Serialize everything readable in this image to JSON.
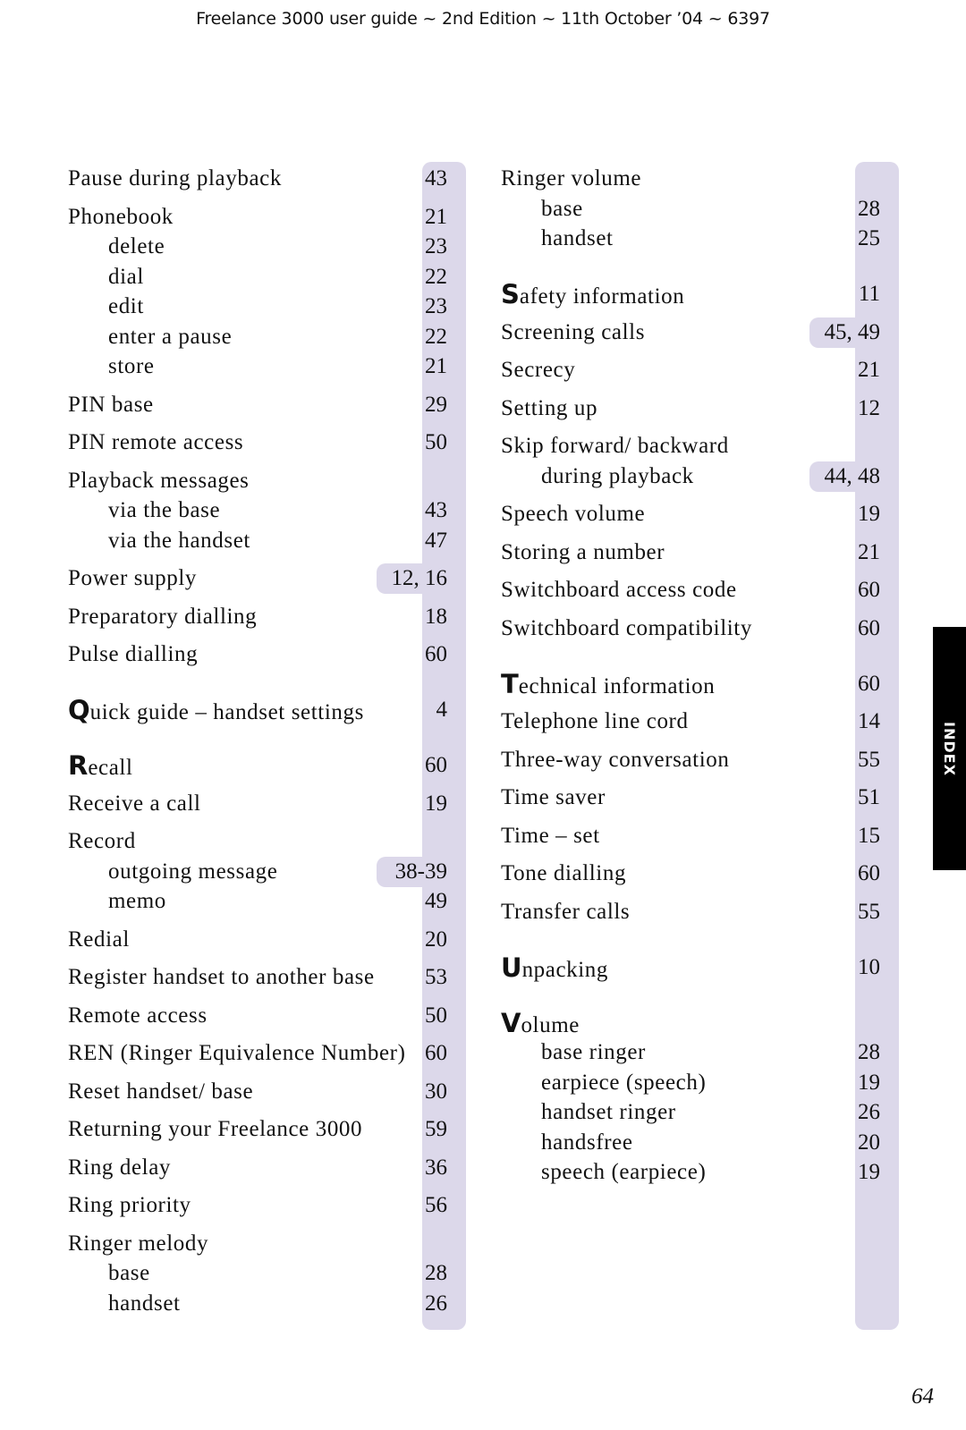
{
  "header": {
    "title": "Freelance 3000 user guide ~ 2nd Edition ~ 11th October ’04 ~ 6397"
  },
  "side_tab": {
    "label": "INDEX"
  },
  "page_number": "64",
  "colors": {
    "band": "#dcd8ea",
    "tab": "#000000",
    "text": "#111111"
  },
  "columns": [
    {
      "entries": [
        {
          "type": "main",
          "text": "Pause during playback",
          "pages": "43"
        },
        {
          "type": "main",
          "text": "Phonebook",
          "pages": "21"
        },
        {
          "type": "sub",
          "text": "delete",
          "pages": "23"
        },
        {
          "type": "sub",
          "text": "dial",
          "pages": "22"
        },
        {
          "type": "sub",
          "text": "edit",
          "pages": "23"
        },
        {
          "type": "sub",
          "text": "enter a pause",
          "pages": "22"
        },
        {
          "type": "sub",
          "text": "store",
          "pages": "21"
        },
        {
          "type": "main",
          "text": "PIN base",
          "pages": "29"
        },
        {
          "type": "main",
          "text": "PIN remote access",
          "pages": "50"
        },
        {
          "type": "main",
          "text": "Playback messages",
          "pages": ""
        },
        {
          "type": "sub",
          "text": "via the base",
          "pages": "43"
        },
        {
          "type": "sub",
          "text": "via the handset",
          "pages": "47"
        },
        {
          "type": "main",
          "text": "Power supply",
          "pages": "12, 16",
          "wide": true
        },
        {
          "type": "main",
          "text": "Preparatory dialling",
          "pages": "18"
        },
        {
          "type": "main",
          "text": "Pulse dialling",
          "pages": "60"
        },
        {
          "type": "letter",
          "cap": "Q",
          "text": "uick guide – handset settings",
          "pages": "4"
        },
        {
          "type": "letter",
          "cap": "R",
          "text": "ecall",
          "pages": "60"
        },
        {
          "type": "main",
          "text": "Receive a call",
          "pages": "19"
        },
        {
          "type": "main",
          "text": "Record",
          "pages": ""
        },
        {
          "type": "sub",
          "text": "outgoing message",
          "pages": "38-39",
          "wide": true
        },
        {
          "type": "sub",
          "text": "memo",
          "pages": "49"
        },
        {
          "type": "main",
          "text": "Redial",
          "pages": "20"
        },
        {
          "type": "main",
          "text": "Register handset to another base",
          "pages": "53"
        },
        {
          "type": "main",
          "text": "Remote access",
          "pages": "50"
        },
        {
          "type": "main",
          "text": "REN (Ringer Equivalence Number)",
          "pages": "60"
        },
        {
          "type": "main",
          "text": "Reset handset/ base",
          "pages": "30"
        },
        {
          "type": "main",
          "text": "Returning your Freelance 3000",
          "pages": "59"
        },
        {
          "type": "main",
          "text": "Ring delay",
          "pages": "36"
        },
        {
          "type": "main",
          "text": "Ring priority",
          "pages": "56"
        },
        {
          "type": "main",
          "text": "Ringer melody",
          "pages": ""
        },
        {
          "type": "sub",
          "text": "base",
          "pages": "28"
        },
        {
          "type": "sub",
          "text": "handset",
          "pages": "26"
        }
      ]
    },
    {
      "entries": [
        {
          "type": "main",
          "text": "Ringer volume",
          "pages": ""
        },
        {
          "type": "sub",
          "text": "base",
          "pages": "28"
        },
        {
          "type": "sub",
          "text": "handset",
          "pages": "25"
        },
        {
          "type": "letter",
          "cap": "S",
          "text": "afety information",
          "pages": "11"
        },
        {
          "type": "main",
          "text": "Screening calls",
          "pages": "45, 49",
          "wide": true
        },
        {
          "type": "main",
          "text": "Secrecy",
          "pages": "21"
        },
        {
          "type": "main",
          "text": "Setting up",
          "pages": "12"
        },
        {
          "type": "main",
          "text": "Skip forward/ backward",
          "pages": ""
        },
        {
          "type": "sub",
          "text": "during playback",
          "pages": "44, 48",
          "wide": true
        },
        {
          "type": "main",
          "text": "Speech volume",
          "pages": "19"
        },
        {
          "type": "main",
          "text": "Storing a number",
          "pages": "21"
        },
        {
          "type": "main",
          "text": "Switchboard access code",
          "pages": "60"
        },
        {
          "type": "main",
          "text": "Switchboard compatibility",
          "pages": "60"
        },
        {
          "type": "letter",
          "cap": "T",
          "text": "echnical information",
          "pages": "60"
        },
        {
          "type": "main",
          "text": "Telephone line cord",
          "pages": "14"
        },
        {
          "type": "main",
          "text": "Three-way conversation",
          "pages": "55"
        },
        {
          "type": "main",
          "text": "Time saver",
          "pages": "51"
        },
        {
          "type": "main",
          "text": "Time – set",
          "pages": "15"
        },
        {
          "type": "main",
          "text": "Tone dialling",
          "pages": "60"
        },
        {
          "type": "main",
          "text": "Transfer calls",
          "pages": "55"
        },
        {
          "type": "letter",
          "cap": "U",
          "text": "npacking",
          "pages": "10"
        },
        {
          "type": "letter",
          "cap": "V",
          "text": "olume",
          "pages": ""
        },
        {
          "type": "sub",
          "text": "base ringer",
          "pages": "28"
        },
        {
          "type": "sub",
          "text": "earpiece (speech)",
          "pages": "19"
        },
        {
          "type": "sub",
          "text": "handset ringer",
          "pages": "26"
        },
        {
          "type": "sub",
          "text": "handsfree",
          "pages": "20"
        },
        {
          "type": "sub",
          "text": "speech (earpiece)",
          "pages": "19"
        }
      ]
    }
  ]
}
